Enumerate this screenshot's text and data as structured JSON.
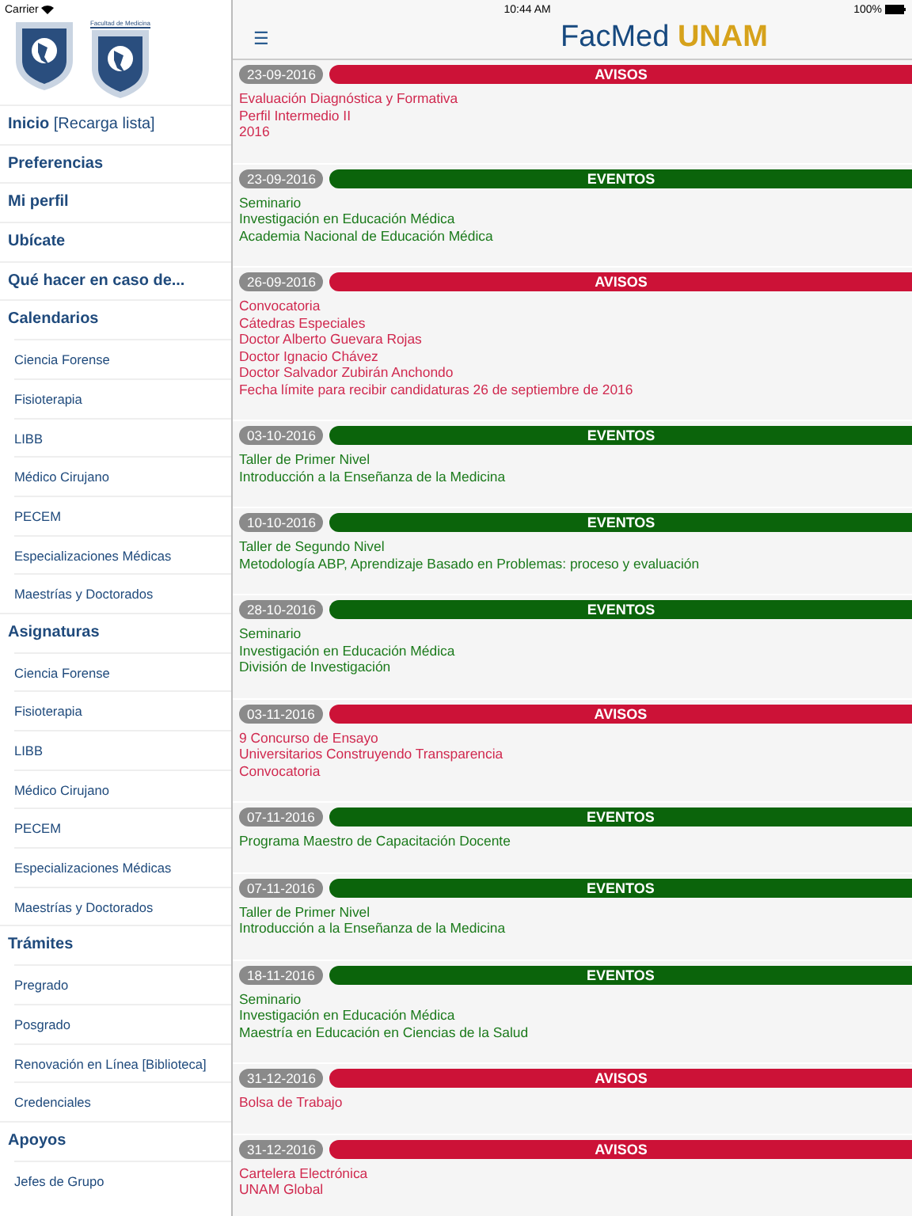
{
  "status_bar": {
    "carrier": "Carrier",
    "time": "10:44 AM",
    "battery": "100%"
  },
  "sidebar": {
    "logo_caption": "Facultad de Medicina",
    "items": [
      {
        "kind": "section",
        "label": "**Inicio** [Recarga lista]"
      },
      {
        "kind": "section",
        "label": "Preferencias"
      },
      {
        "kind": "section",
        "label": "Mi perfil"
      },
      {
        "kind": "section",
        "label": "Ubícate"
      },
      {
        "kind": "section",
        "label": "Qué hacer en caso de..."
      },
      {
        "kind": "section",
        "label": "Calendarios"
      },
      {
        "kind": "sub",
        "label": "Ciencia Forense"
      },
      {
        "kind": "sub",
        "label": "Fisioterapia"
      },
      {
        "kind": "sub",
        "label": "LIBB"
      },
      {
        "kind": "sub",
        "label": "Médico Cirujano"
      },
      {
        "kind": "sub",
        "label": "PECEM"
      },
      {
        "kind": "sub",
        "label": "Especializaciones Médicas"
      },
      {
        "kind": "sub",
        "label": "Maestrías y Doctorados"
      },
      {
        "kind": "section",
        "label": "Asignaturas"
      },
      {
        "kind": "sub",
        "label": "Ciencia Forense"
      },
      {
        "kind": "sub",
        "label": "Fisioterapia"
      },
      {
        "kind": "sub",
        "label": "LIBB"
      },
      {
        "kind": "sub",
        "label": "Médico Cirujano"
      },
      {
        "kind": "sub",
        "label": "PECEM"
      },
      {
        "kind": "sub",
        "label": "Especializaciones Médicas"
      },
      {
        "kind": "sub",
        "label": "Maestrías y Doctorados"
      },
      {
        "kind": "section",
        "label": "Trámites"
      },
      {
        "kind": "sub",
        "label": "Pregrado"
      },
      {
        "kind": "sub",
        "label": "Posgrado"
      },
      {
        "kind": "sub",
        "label": "Renovación en Línea [Biblioteca]"
      },
      {
        "kind": "sub",
        "label": "Credenciales"
      },
      {
        "kind": "section",
        "label": "Apoyos"
      },
      {
        "kind": "sub",
        "label": "Jefes de Grupo"
      }
    ]
  },
  "header": {
    "menu": "☰",
    "title": "FacMed **UNAM**"
  },
  "feed": [
    {
      "kind": "avisos",
      "date": "23-09-2016",
      "category": "AVISOS",
      "lines": [
        "Evaluación Diagnóstica y Formativa",
        "Perfil Intermedio II",
        "2016"
      ]
    },
    {
      "kind": "eventos",
      "date": "23-09-2016",
      "category": "EVENTOS",
      "lines": [
        "Seminario",
        "Investigación en Educación Médica",
        "Academia Nacional de Educación Médica"
      ]
    },
    {
      "kind": "avisos",
      "date": "26-09-2016",
      "category": "AVISOS",
      "lines": [
        "Convocatoria",
        "Cátedras Especiales",
        "Doctor Alberto Guevara Rojas",
        "Doctor Ignacio Chávez",
        "Doctor Salvador Zubirán Anchondo",
        "Fecha límite para recibir candidaturas 26 de septiembre de 2016"
      ]
    },
    {
      "kind": "eventos",
      "date": "03-10-2016",
      "category": "EVENTOS",
      "lines": [
        "Taller de Primer Nivel",
        "Introducción a la Enseñanza de la Medicina"
      ]
    },
    {
      "kind": "eventos",
      "date": "10-10-2016",
      "category": "EVENTOS",
      "lines": [
        "Taller de Segundo Nivel",
        "Metodología ABP, Aprendizaje Basado en Problemas: proceso y evaluación"
      ]
    },
    {
      "kind": "eventos",
      "date": "28-10-2016",
      "category": "EVENTOS",
      "lines": [
        "Seminario",
        "Investigación en Educación Médica",
        "División de Investigación"
      ]
    },
    {
      "kind": "avisos",
      "date": "03-11-2016",
      "category": "AVISOS",
      "lines": [
        "9 Concurso de Ensayo",
        "Universitarios Construyendo Transparencia",
        "Convocatoria"
      ]
    },
    {
      "kind": "eventos",
      "date": "07-11-2016",
      "category": "EVENTOS",
      "lines": [
        "Programa Maestro de Capacitación Docente"
      ]
    },
    {
      "kind": "eventos",
      "date": "07-11-2016",
      "category": "EVENTOS",
      "lines": [
        "Taller de Primer Nivel",
        "Introducción a la Enseñanza de la Medicina"
      ]
    },
    {
      "kind": "eventos",
      "date": "18-11-2016",
      "category": "EVENTOS",
      "lines": [
        "Seminario",
        "Investigación en Educación Médica",
        "Maestría en Educación en Ciencias de la Salud"
      ]
    },
    {
      "kind": "avisos",
      "date": "31-12-2016",
      "category": "AVISOS",
      "lines": [
        "Bolsa de Trabajo"
      ]
    },
    {
      "kind": "avisos",
      "date": "31-12-2016",
      "category": "AVISOS",
      "lines": [
        "Cartelera Electrónica",
        "UNAM Global"
      ]
    }
  ]
}
